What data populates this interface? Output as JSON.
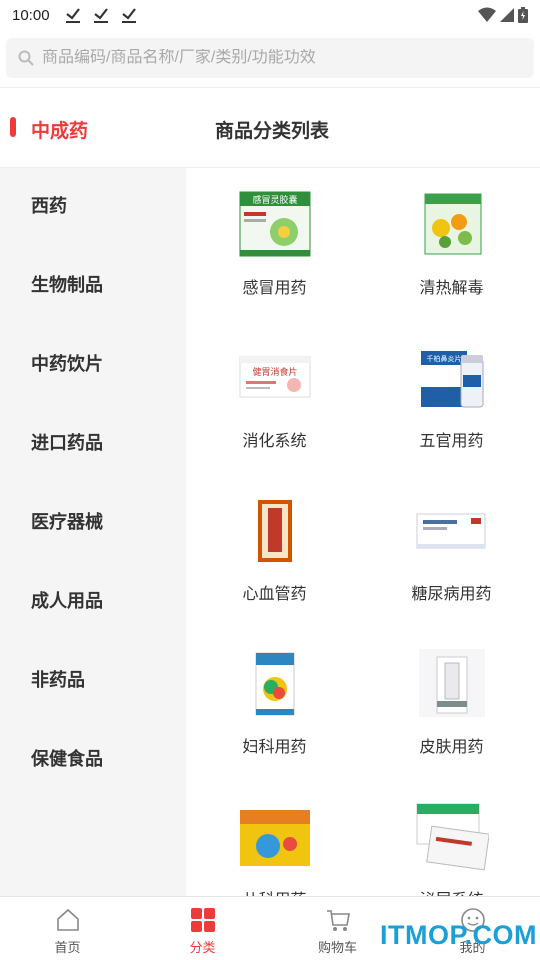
{
  "status_bar": {
    "time": "10:00"
  },
  "search": {
    "placeholder": "商品编码/商品名称/厂家/类别/功能功效"
  },
  "header": {
    "active_category": "中成药",
    "list_title": "商品分类列表"
  },
  "sidebar": {
    "items": [
      {
        "label": "西药"
      },
      {
        "label": "生物制品"
      },
      {
        "label": "中药饮片"
      },
      {
        "label": "进口药品"
      },
      {
        "label": "医疗器械"
      },
      {
        "label": "成人用品"
      },
      {
        "label": "非药品"
      },
      {
        "label": "保健食品"
      }
    ]
  },
  "grid": {
    "items": [
      {
        "label": "感冒用药",
        "thumb_text": "感冒灵胶囊",
        "color": "#2f8f3a"
      },
      {
        "label": "清热解毒",
        "thumb_text": "",
        "color": "#3aa04a"
      },
      {
        "label": "消化系统",
        "thumb_text": "健胃消食片",
        "color": "#c0392b"
      },
      {
        "label": "五官用药",
        "thumb_text": "千柏鼻炎片",
        "color": "#1f5fa8"
      },
      {
        "label": "心血管药",
        "thumb_text": "",
        "color": "#d35400"
      },
      {
        "label": "糖尿病用药",
        "thumb_text": "",
        "color": "#4a6fa5"
      },
      {
        "label": "妇科用药",
        "thumb_text": "",
        "color": "#2e86c1"
      },
      {
        "label": "皮肤用药",
        "thumb_text": "",
        "color": "#7f8c8d"
      },
      {
        "label": "儿科用药",
        "thumb_text": "",
        "color": "#f1c40f"
      },
      {
        "label": "泌尿系统",
        "thumb_text": "",
        "color": "#27ae60"
      }
    ]
  },
  "bottom_nav": {
    "items": [
      {
        "label": "首页",
        "icon": "home-icon"
      },
      {
        "label": "分类",
        "icon": "category-icon"
      },
      {
        "label": "购物车",
        "icon": "cart-icon"
      },
      {
        "label": "我的",
        "icon": "user-icon"
      }
    ],
    "active_index": 1,
    "active_color": "#ee3a3a"
  },
  "watermark": {
    "text": "ITMOP.COM"
  }
}
